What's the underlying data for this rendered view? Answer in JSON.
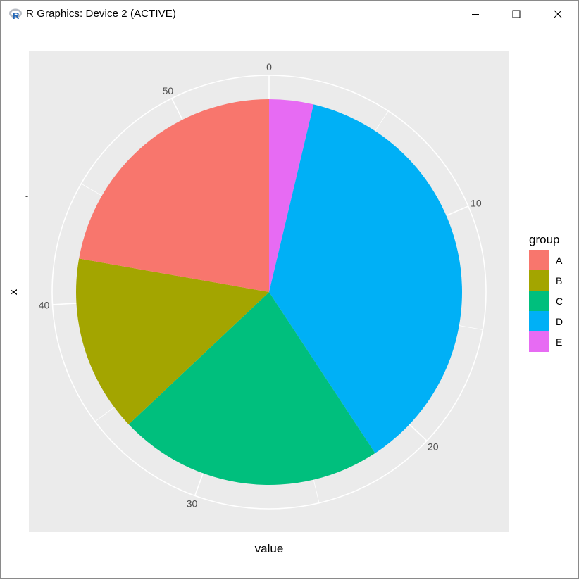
{
  "window": {
    "title": "R Graphics: Device 2 (ACTIVE)",
    "controls": [
      "minimize",
      "maximize",
      "close"
    ],
    "icon": "r-logo-icon"
  },
  "chart_data": {
    "type": "pie",
    "xlabel": "value",
    "ylabel": "x",
    "y_tick_label": "-",
    "legend": {
      "title": "group",
      "placement": "right"
    },
    "theta_ticks": [
      "0",
      "10",
      "20",
      "30",
      "40",
      "50"
    ],
    "theta_range": [
      0,
      54
    ],
    "slices": [
      {
        "label": "E",
        "value": 2,
        "color": "#E76BF3"
      },
      {
        "label": "D",
        "value": 20,
        "color": "#00B0F6"
      },
      {
        "label": "C",
        "value": 12,
        "color": "#00BF7D"
      },
      {
        "label": "B",
        "value": 8,
        "color": "#A3A500"
      },
      {
        "label": "A",
        "value": 12,
        "color": "#F8766D"
      }
    ],
    "legend_items": [
      {
        "label": "A",
        "color": "#F8766D"
      },
      {
        "label": "B",
        "color": "#A3A500"
      },
      {
        "label": "C",
        "color": "#00BF7D"
      },
      {
        "label": "D",
        "color": "#00B0F6"
      },
      {
        "label": "E",
        "color": "#E76BF3"
      }
    ],
    "panel_background": "#EBEBEB",
    "grid": true
  }
}
